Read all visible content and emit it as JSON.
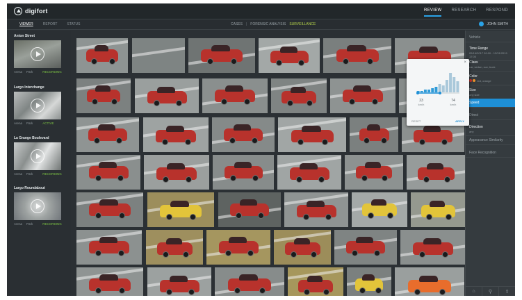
{
  "app": {
    "name": "digifort"
  },
  "topnav": [
    {
      "label": "REVIEW",
      "active": true
    },
    {
      "label": "RESEARCH",
      "active": false
    },
    {
      "label": "RESPOND",
      "active": false
    }
  ],
  "subtabs": [
    {
      "label": "VIEWER",
      "active": true
    },
    {
      "label": "REPORT",
      "active": false
    },
    {
      "label": "STATUS",
      "active": false
    }
  ],
  "modes": {
    "first": "CASES",
    "second": "FORENSIC ANALYSIS",
    "third": "SURVEILLANCE",
    "separator": "|"
  },
  "user": {
    "name": "JOHN SMITH"
  },
  "cameras": [
    {
      "title": "Anton Street",
      "left": "Arena",
      "mid": "Park",
      "status": "RECORDING"
    },
    {
      "title": "Largo Interchange",
      "left": "Arena",
      "mid": "Park",
      "status": "ACTIVE"
    },
    {
      "title": "La Grange Boulevard",
      "left": "Arena",
      "mid": "Park",
      "status": "RECORDING"
    },
    {
      "title": "Largo Roundabout",
      "left": "Arena",
      "mid": "Park",
      "status": "RECORDING"
    }
  ],
  "facets": [
    {
      "title": "Vehicle",
      "sub": ""
    },
    {
      "title": "Time Range",
      "sub": "05/16/2017 09:00 - 12/31/2019 17:00"
    },
    {
      "title": "Class",
      "sub": "car, sedan, suv, truck"
    },
    {
      "title": "Color",
      "sub": "red, orange"
    },
    {
      "title": "Size",
      "sub": "any size"
    },
    {
      "title": "Speed",
      "sub": ""
    },
    {
      "title": "Direct",
      "sub": ""
    },
    {
      "title": "Direction",
      "sub": "any"
    },
    {
      "title": "Appearance Similarity",
      "sub": ""
    },
    {
      "title": "Face Recognition",
      "sub": ""
    }
  ],
  "popover": {
    "close": "×",
    "min_value": "23",
    "min_unit": "km/h",
    "max_value": "74",
    "max_unit": "km/h",
    "reset": "RESET",
    "apply": "APPLY",
    "histogram": [
      1,
      1,
      2,
      2,
      3,
      4,
      6,
      5,
      9,
      14,
      11,
      8
    ]
  },
  "bottom_icons": [
    "home-icon",
    "filter-icon",
    "share-icon"
  ],
  "colors": {
    "accent": "#1e8fd6",
    "status_green": "#7cc243",
    "car_red": "#b8322c",
    "car_yellow": "#e2c43a"
  }
}
